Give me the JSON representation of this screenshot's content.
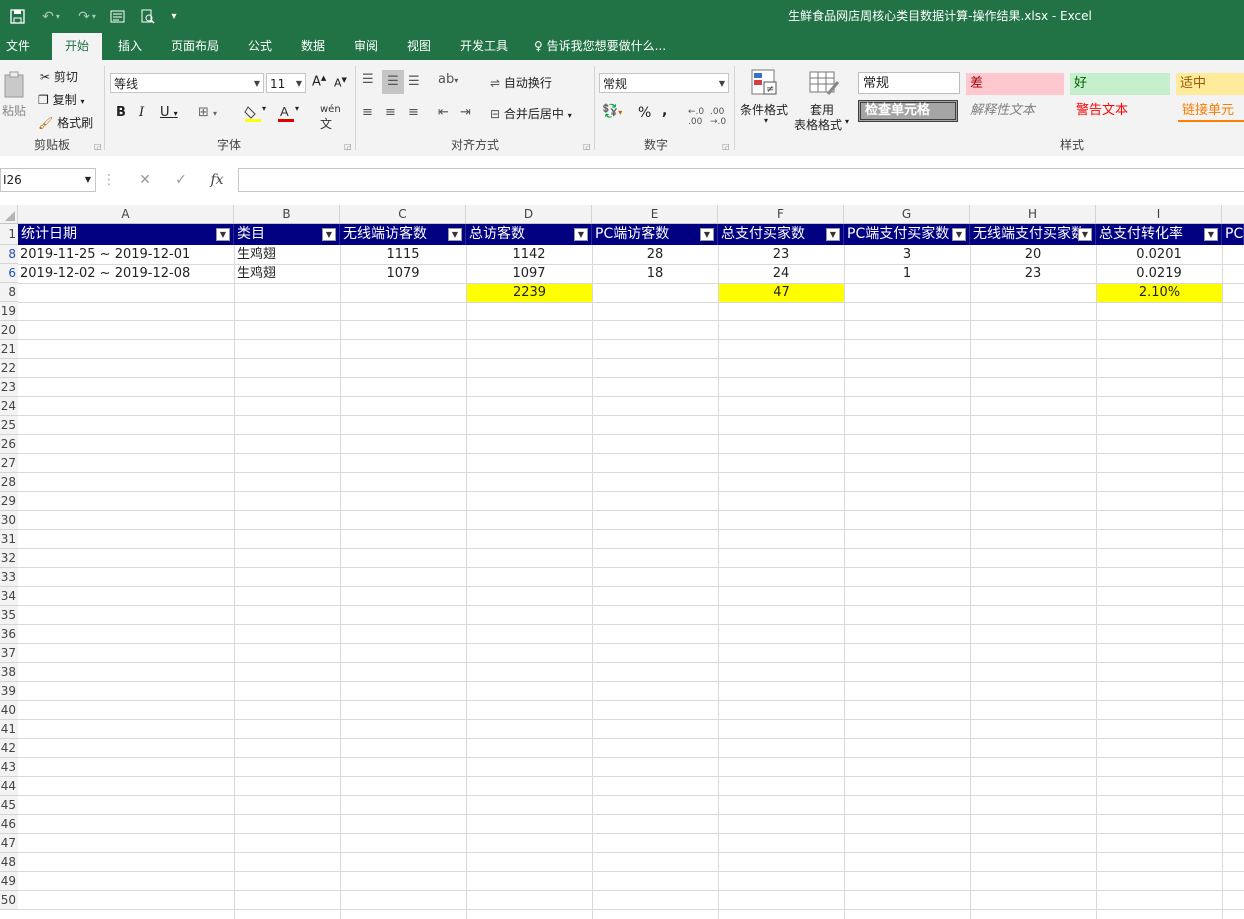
{
  "window": {
    "title": "生鲜食品网店周核心类目数据计算-操作结果.xlsx - Excel"
  },
  "tabs": [
    "文件",
    "开始",
    "插入",
    "页面布局",
    "公式",
    "数据",
    "审阅",
    "视图",
    "开发工具"
  ],
  "tell_me": "告诉我您想要做什么...",
  "ribbon": {
    "clipboard": {
      "paste": "粘贴",
      "cut": "剪切",
      "copy": "复制",
      "format_painter": "格式刷",
      "label": "剪贴板"
    },
    "font": {
      "name": "等线",
      "size": "11",
      "bold": "B",
      "italic": "I",
      "underline": "U",
      "label": "字体"
    },
    "alignment": {
      "wrap": "自动换行",
      "merge": "合并后居中",
      "label": "对齐方式"
    },
    "number": {
      "format": "常规",
      "percent": "%",
      "comma": ",",
      "label": "数字"
    },
    "styles": {
      "conditional": "条件格式",
      "table_format_1": "套用",
      "table_format_2": "表格格式",
      "normal": "常规",
      "bad": "差",
      "good": "好",
      "neutral": "适中",
      "check_cell": "检查单元格",
      "explanatory": "解释性文本",
      "warning": "警告文本",
      "linked": "链接单元格",
      "label": "样式"
    }
  },
  "formula_bar": {
    "name_box": "I26",
    "fx": "fx",
    "value": ""
  },
  "columns": [
    "A",
    "B",
    "C",
    "D",
    "E",
    "F",
    "G",
    "H",
    "I"
  ],
  "table": {
    "headers": [
      "统计日期",
      "类目",
      "无线端访客数",
      "总访客数",
      "PC端访客数",
      "总支付买家数",
      "PC端支付买家数",
      "无线端支付买家数",
      "总支付转化率",
      "PC"
    ],
    "rows": [
      {
        "row_num": "8",
        "cells": [
          "2019-11-25 ~ 2019-12-01",
          "生鸡翅",
          "1115",
          "1142",
          "28",
          "23",
          "3",
          "20",
          "0.0201"
        ]
      },
      {
        "row_num": "6",
        "cells": [
          "2019-12-02 ~ 2019-12-08",
          "生鸡翅",
          "1079",
          "1097",
          "18",
          "24",
          "1",
          "23",
          "0.0219"
        ]
      }
    ],
    "totals": {
      "row_num": "8",
      "D": "2239",
      "F": "47",
      "I": "2.10%"
    }
  },
  "header_row_num": "1",
  "row_numbers": [
    "19",
    "20",
    "21",
    "22",
    "23",
    "24",
    "25",
    "26",
    "27",
    "28",
    "29",
    "30",
    "31",
    "32",
    "33",
    "34",
    "35",
    "36",
    "37",
    "38",
    "39",
    "40",
    "41",
    "42",
    "43",
    "44",
    "45",
    "46",
    "47",
    "48",
    "49",
    "50"
  ],
  "colors": {
    "excel_green": "#217346",
    "header_fill": "#000080",
    "highlight": "#ffff00"
  }
}
